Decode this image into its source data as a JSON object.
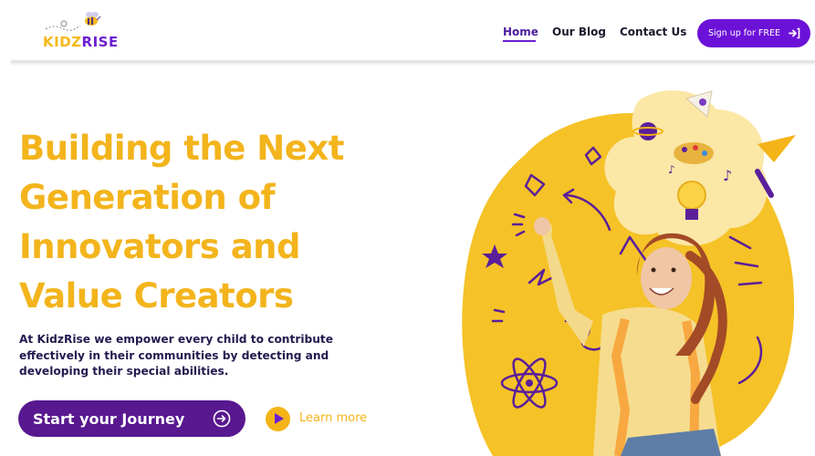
{
  "brand": {
    "logo_part1": "KIDZ",
    "logo_part2": "RISE"
  },
  "nav": {
    "home": "Home",
    "blog": "Our Blog",
    "contact": "Contact Us",
    "signup": "Sign up for FREE"
  },
  "hero": {
    "title_lines": [
      "Building the Next",
      "Generation of",
      "Innovators and",
      "Value Creators"
    ],
    "description_lines": [
      "At KidzRise we empower every child to contribute",
      "effectively in their communities by detecting and",
      "developing their special abilities."
    ],
    "cta_primary": "Start your Journey",
    "cta_secondary": "Learn more"
  },
  "colors": {
    "accent_yellow": "#f3b41c",
    "accent_purple": "#6c12d8",
    "button_purple": "#58188f",
    "text_dark": "#241a4f"
  },
  "icons": [
    "signup-arrow-icon",
    "arrow-circle-right-icon",
    "play-icon"
  ]
}
